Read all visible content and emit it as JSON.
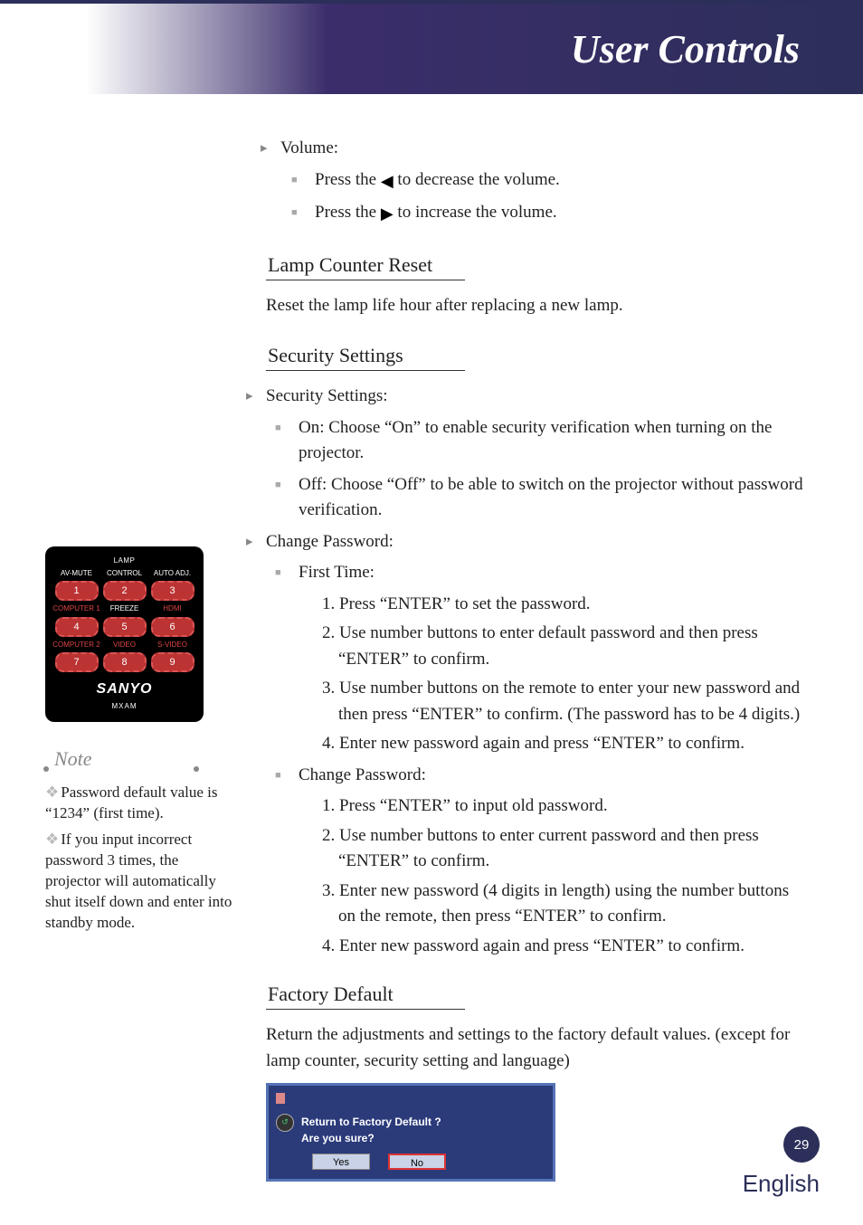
{
  "header": {
    "title": "User Controls"
  },
  "volume": {
    "heading": "Volume:",
    "decrease_pre": "Press the ",
    "decrease_post": " to decrease the volume.",
    "increase_pre": "Press the ",
    "increase_post": " to increase the volume."
  },
  "lamp": {
    "heading": "Lamp Counter Reset",
    "body": "Reset the lamp life hour after replacing a new lamp."
  },
  "security": {
    "heading": "Security Settings",
    "settings_label": "Security Settings:",
    "on": "On: Choose “On” to enable security verification when turning on the projector.",
    "off": "Off: Choose “Off” to be able to switch on the projector without password verification.",
    "change_pw_label": "Change Password:",
    "first_time_label": "First Time:",
    "first_time_steps": [
      "1. Press “ENTER” to set the password.",
      "2. Use number buttons to enter default password and then press “ENTER” to confirm.",
      "3. Use number buttons on the remote to enter your new password and then press “ENTER” to confirm. (The password has to be 4 digits.)",
      "4. Enter new password again and press “ENTER” to confirm."
    ],
    "change_label": "Change Password:",
    "change_steps": [
      "1. Press “ENTER” to input old password.",
      "2. Use number buttons to enter current password and then press “ENTER” to confirm.",
      "3. Enter new password (4 digits in length) using the number buttons on the remote, then press “ENTER” to confirm.",
      "4. Enter new password again and press “ENTER” to confirm."
    ]
  },
  "factory": {
    "heading": "Factory Default",
    "body": "Return the adjustments and settings to the factory default values. (except for lamp counter, security setting and language)",
    "dialog": {
      "title": "Return to Factory Default ?",
      "prompt": "Are you sure?",
      "yes": "Yes",
      "no": "No"
    }
  },
  "remote": {
    "top_center": "LAMP",
    "row1_labels": [
      "AV-MUTE",
      "CONTROL",
      "AUTO ADJ."
    ],
    "row1_nums": [
      "1",
      "2",
      "3"
    ],
    "row2_labels": [
      "COMPUTER 1",
      "FREEZE",
      "HDMI"
    ],
    "row2_nums": [
      "4",
      "5",
      "6"
    ],
    "row3_labels": [
      "COMPUTER 2",
      "VIDEO",
      "S-VIDEO"
    ],
    "row3_nums": [
      "7",
      "8",
      "9"
    ],
    "brand": "SANYO",
    "model": "MXAM"
  },
  "notes": {
    "label": "Note",
    "items": [
      "Password default value is “1234” (first time).",
      "If you input incorrect password 3 times, the projector will automatically shut itself down and enter into standby mode."
    ]
  },
  "footer": {
    "page": "29",
    "language": "English"
  }
}
